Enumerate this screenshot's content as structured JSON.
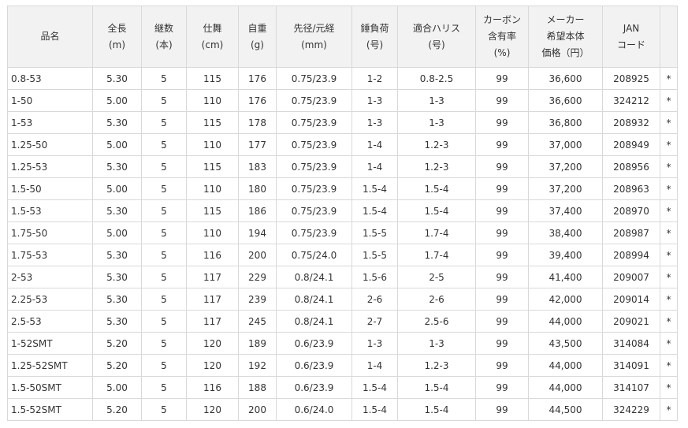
{
  "table": {
    "headers": [
      {
        "lines": [
          "品名"
        ]
      },
      {
        "lines": [
          "全長",
          "(m)"
        ]
      },
      {
        "lines": [
          "継数",
          "(本)"
        ]
      },
      {
        "lines": [
          "仕舞",
          "(cm)"
        ]
      },
      {
        "lines": [
          "自重",
          "(g)"
        ]
      },
      {
        "lines": [
          "先径/元経",
          "(mm)"
        ]
      },
      {
        "lines": [
          "錘負荷",
          "(号)"
        ]
      },
      {
        "lines": [
          "適合ハリス",
          "(号)"
        ]
      },
      {
        "lines": [
          "カーボン",
          "含有率",
          "(%)"
        ]
      },
      {
        "lines": [
          "メーカー",
          "希望本体",
          "価格（円）"
        ]
      },
      {
        "lines": [
          "JAN",
          "コード"
        ]
      },
      {
        "lines": [
          ""
        ]
      }
    ],
    "rows": [
      [
        "0.8-53",
        "5.30",
        "5",
        "115",
        "176",
        "0.75/23.9",
        "1-2",
        "0.8-2.5",
        "99",
        "36,600",
        "208925",
        "*"
      ],
      [
        "1-50",
        "5.00",
        "5",
        "110",
        "176",
        "0.75/23.9",
        "1-3",
        "1-3",
        "99",
        "36,600",
        "324212",
        "*"
      ],
      [
        "1-53",
        "5.30",
        "5",
        "115",
        "178",
        "0.75/23.9",
        "1-3",
        "1-3",
        "99",
        "36,800",
        "208932",
        "*"
      ],
      [
        "1.25-50",
        "5.00",
        "5",
        "110",
        "177",
        "0.75/23.9",
        "1-4",
        "1.2-3",
        "99",
        "37,000",
        "208949",
        "*"
      ],
      [
        "1.25-53",
        "5.30",
        "5",
        "115",
        "183",
        "0.75/23.9",
        "1-4",
        "1.2-3",
        "99",
        "37,200",
        "208956",
        "*"
      ],
      [
        "1.5-50",
        "5.00",
        "5",
        "110",
        "180",
        "0.75/23.9",
        "1.5-4",
        "1.5-4",
        "99",
        "37,200",
        "208963",
        "*"
      ],
      [
        "1.5-53",
        "5.30",
        "5",
        "115",
        "186",
        "0.75/23.9",
        "1.5-4",
        "1.5-4",
        "99",
        "37,400",
        "208970",
        "*"
      ],
      [
        "1.75-50",
        "5.00",
        "5",
        "110",
        "194",
        "0.75/23.9",
        "1.5-5",
        "1.7-4",
        "99",
        "38,400",
        "208987",
        "*"
      ],
      [
        "1.75-53",
        "5.30",
        "5",
        "116",
        "200",
        "0.75/24.0",
        "1.5-5",
        "1.7-4",
        "99",
        "39,400",
        "208994",
        "*"
      ],
      [
        "2-53",
        "5.30",
        "5",
        "117",
        "229",
        "0.8/24.1",
        "1.5-6",
        "2-5",
        "99",
        "41,400",
        "209007",
        "*"
      ],
      [
        "2.25-53",
        "5.30",
        "5",
        "117",
        "239",
        "0.8/24.1",
        "2-6",
        "2-6",
        "99",
        "42,000",
        "209014",
        "*"
      ],
      [
        "2.5-53",
        "5.30",
        "5",
        "117",
        "245",
        "0.8/24.1",
        "2-7",
        "2.5-6",
        "99",
        "44,000",
        "209021",
        "*"
      ],
      [
        "1-52SMT",
        "5.20",
        "5",
        "120",
        "189",
        "0.6/23.9",
        "1-3",
        "1-3",
        "99",
        "43,500",
        "314084",
        "*"
      ],
      [
        "1.25-52SMT",
        "5.20",
        "5",
        "120",
        "192",
        "0.6/23.9",
        "1-4",
        "1.2-3",
        "99",
        "44,000",
        "314091",
        "*"
      ],
      [
        "1.5-50SMT",
        "5.00",
        "5",
        "116",
        "188",
        "0.6/23.9",
        "1.5-4",
        "1.5-4",
        "99",
        "44,000",
        "314107",
        "*"
      ],
      [
        "1.5-52SMT",
        "5.20",
        "5",
        "120",
        "200",
        "0.6/24.0",
        "1.5-4",
        "1.5-4",
        "99",
        "44,500",
        "324229",
        "*"
      ]
    ]
  }
}
